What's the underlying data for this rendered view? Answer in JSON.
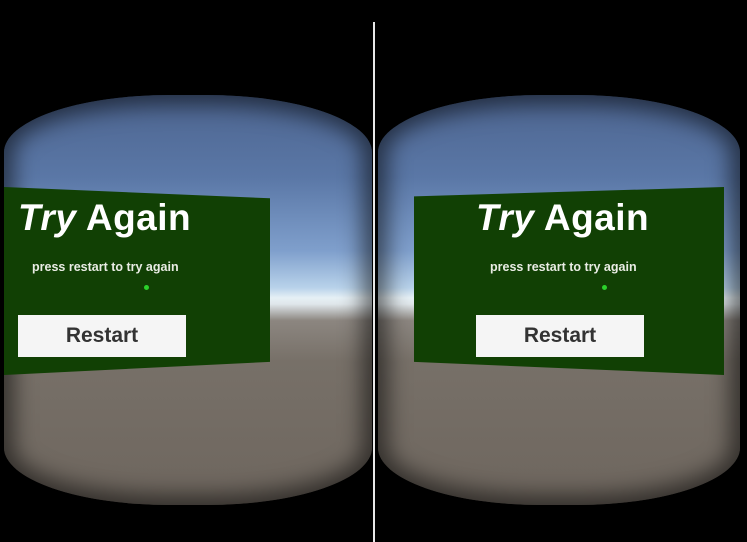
{
  "screen": {
    "title_prefix": "Try",
    "title_suffix": "Again",
    "subtitle": "press restart to try again",
    "restart_label": "Restart"
  },
  "colors": {
    "panel": "#114004",
    "reticle": "#2bd12b",
    "button": "#f5f5f5",
    "button_text": "#333333"
  },
  "icons": [
    "gaze-reticle-icon"
  ]
}
